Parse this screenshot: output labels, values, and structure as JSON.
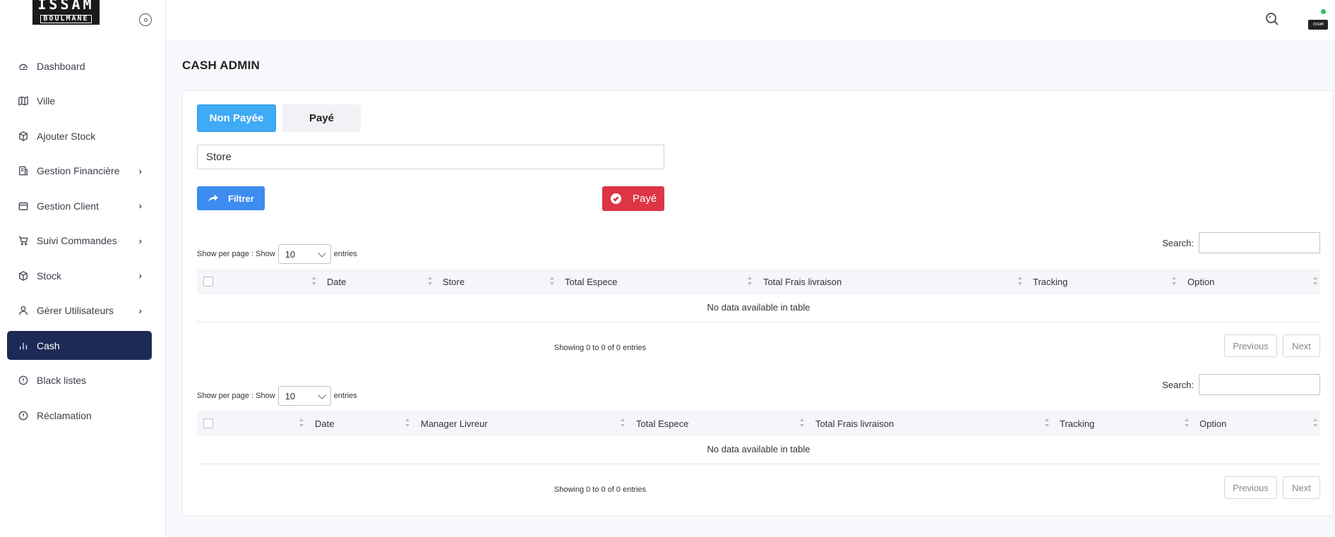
{
  "logo": {
    "line1": "ISSAM",
    "line2": "BOULMANE"
  },
  "sidebar": {
    "items": [
      {
        "label": "Dashboard",
        "icon": "dashboard-icon",
        "chevron": false,
        "active": false
      },
      {
        "label": "Ville",
        "icon": "map-icon",
        "chevron": false,
        "active": false
      },
      {
        "label": "Ajouter Stock",
        "icon": "box-icon",
        "chevron": false,
        "active": false
      },
      {
        "label": "Gestion Financière",
        "icon": "finance-icon",
        "chevron": true,
        "active": false
      },
      {
        "label": "Gestion Client",
        "icon": "client-icon",
        "chevron": true,
        "active": false
      },
      {
        "label": "Suivi Commandes",
        "icon": "cart-icon",
        "chevron": true,
        "active": false
      },
      {
        "label": "Stock",
        "icon": "box-icon",
        "chevron": true,
        "active": false
      },
      {
        "label": "Gérer Utilisateurs",
        "icon": "user-icon",
        "chevron": true,
        "active": false
      },
      {
        "label": "Cash",
        "icon": "bar-chart-icon",
        "chevron": false,
        "active": true
      },
      {
        "label": "Black listes",
        "icon": "alert-circle-icon",
        "chevron": false,
        "active": false
      },
      {
        "label": "Réclamation",
        "icon": "alert-circle-icon",
        "chevron": false,
        "active": false
      }
    ]
  },
  "header": {
    "avatar_text": "ISSAM"
  },
  "page": {
    "title": "CASH ADMIN"
  },
  "tabs": {
    "non_payee": "Non Payée",
    "paye": "Payé"
  },
  "filters": {
    "store_value": "Store",
    "filter_button": "Filtrer",
    "paye_button": "Payé"
  },
  "table1": {
    "length_prefix": "Show per page :  Show",
    "length_value": "10",
    "length_suffix": "entries",
    "search_label": "Search:",
    "columns": [
      "Date",
      "Store",
      "Total Espece",
      "Total Frais livraison",
      "Tracking",
      "Option"
    ],
    "empty": "No data available in table",
    "info": "Showing 0 to 0 of 0 entries",
    "prev": "Previous",
    "next": "Next"
  },
  "table2": {
    "length_prefix": "Show per page :  Show",
    "length_value": "10",
    "length_suffix": "entries",
    "search_label": "Search:",
    "columns": [
      "Date",
      "Manager Livreur",
      "Total Espece",
      "Total Frais livraison",
      "Tracking",
      "Option"
    ],
    "empty": "No data available in table",
    "info": "Showing 0 to 0 of 0 entries",
    "prev": "Previous",
    "next": "Next"
  },
  "colors": {
    "sidebar_active": "#1c2a55",
    "tab_active": "#3faaf5",
    "filter_btn": "#3d8cf0",
    "paye_btn": "#dc3545",
    "status_dot": "#22c55e"
  }
}
